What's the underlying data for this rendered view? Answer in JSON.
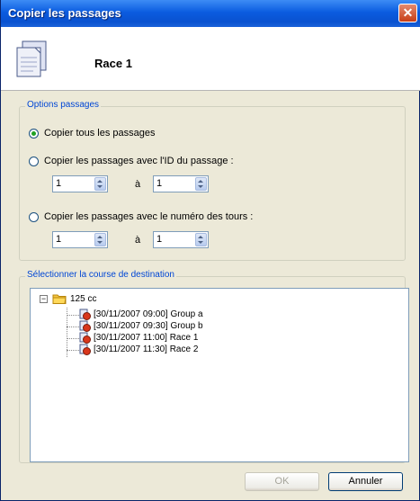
{
  "window": {
    "title": "Copier les passages",
    "close_symbol": "✕"
  },
  "header": {
    "title": "Race 1"
  },
  "options": {
    "legend": "Options passages",
    "radio_all": "Copier tous les passages",
    "radio_by_id": "Copier les passages avec l'ID du passage :",
    "radio_by_lap": "Copier les passages avec le numéro des tours :",
    "id_from": "1",
    "id_to": "1",
    "lap_from": "1",
    "lap_to": "1",
    "range_separator": "à",
    "selected": "radio_all"
  },
  "destination": {
    "legend": "Sélectionner la course de destination",
    "root": {
      "label": "125 cc",
      "expander": "−"
    },
    "races": [
      "[30/11/2007 09:00] Group a",
      "[30/11/2007 09:30] Group b",
      "[30/11/2007 11:00] Race 1",
      "[30/11/2007 11:30] Race 2"
    ]
  },
  "buttons": {
    "ok": "OK",
    "cancel": "Annuler",
    "ok_enabled": false
  },
  "icons": {
    "document": "document-copy-icon",
    "folder": "folder-icon",
    "race": "race-flag-icon"
  },
  "colors": {
    "titlebar": "#0a52d0",
    "legend": "#0046d5",
    "window_bg": "#ece9d8"
  }
}
